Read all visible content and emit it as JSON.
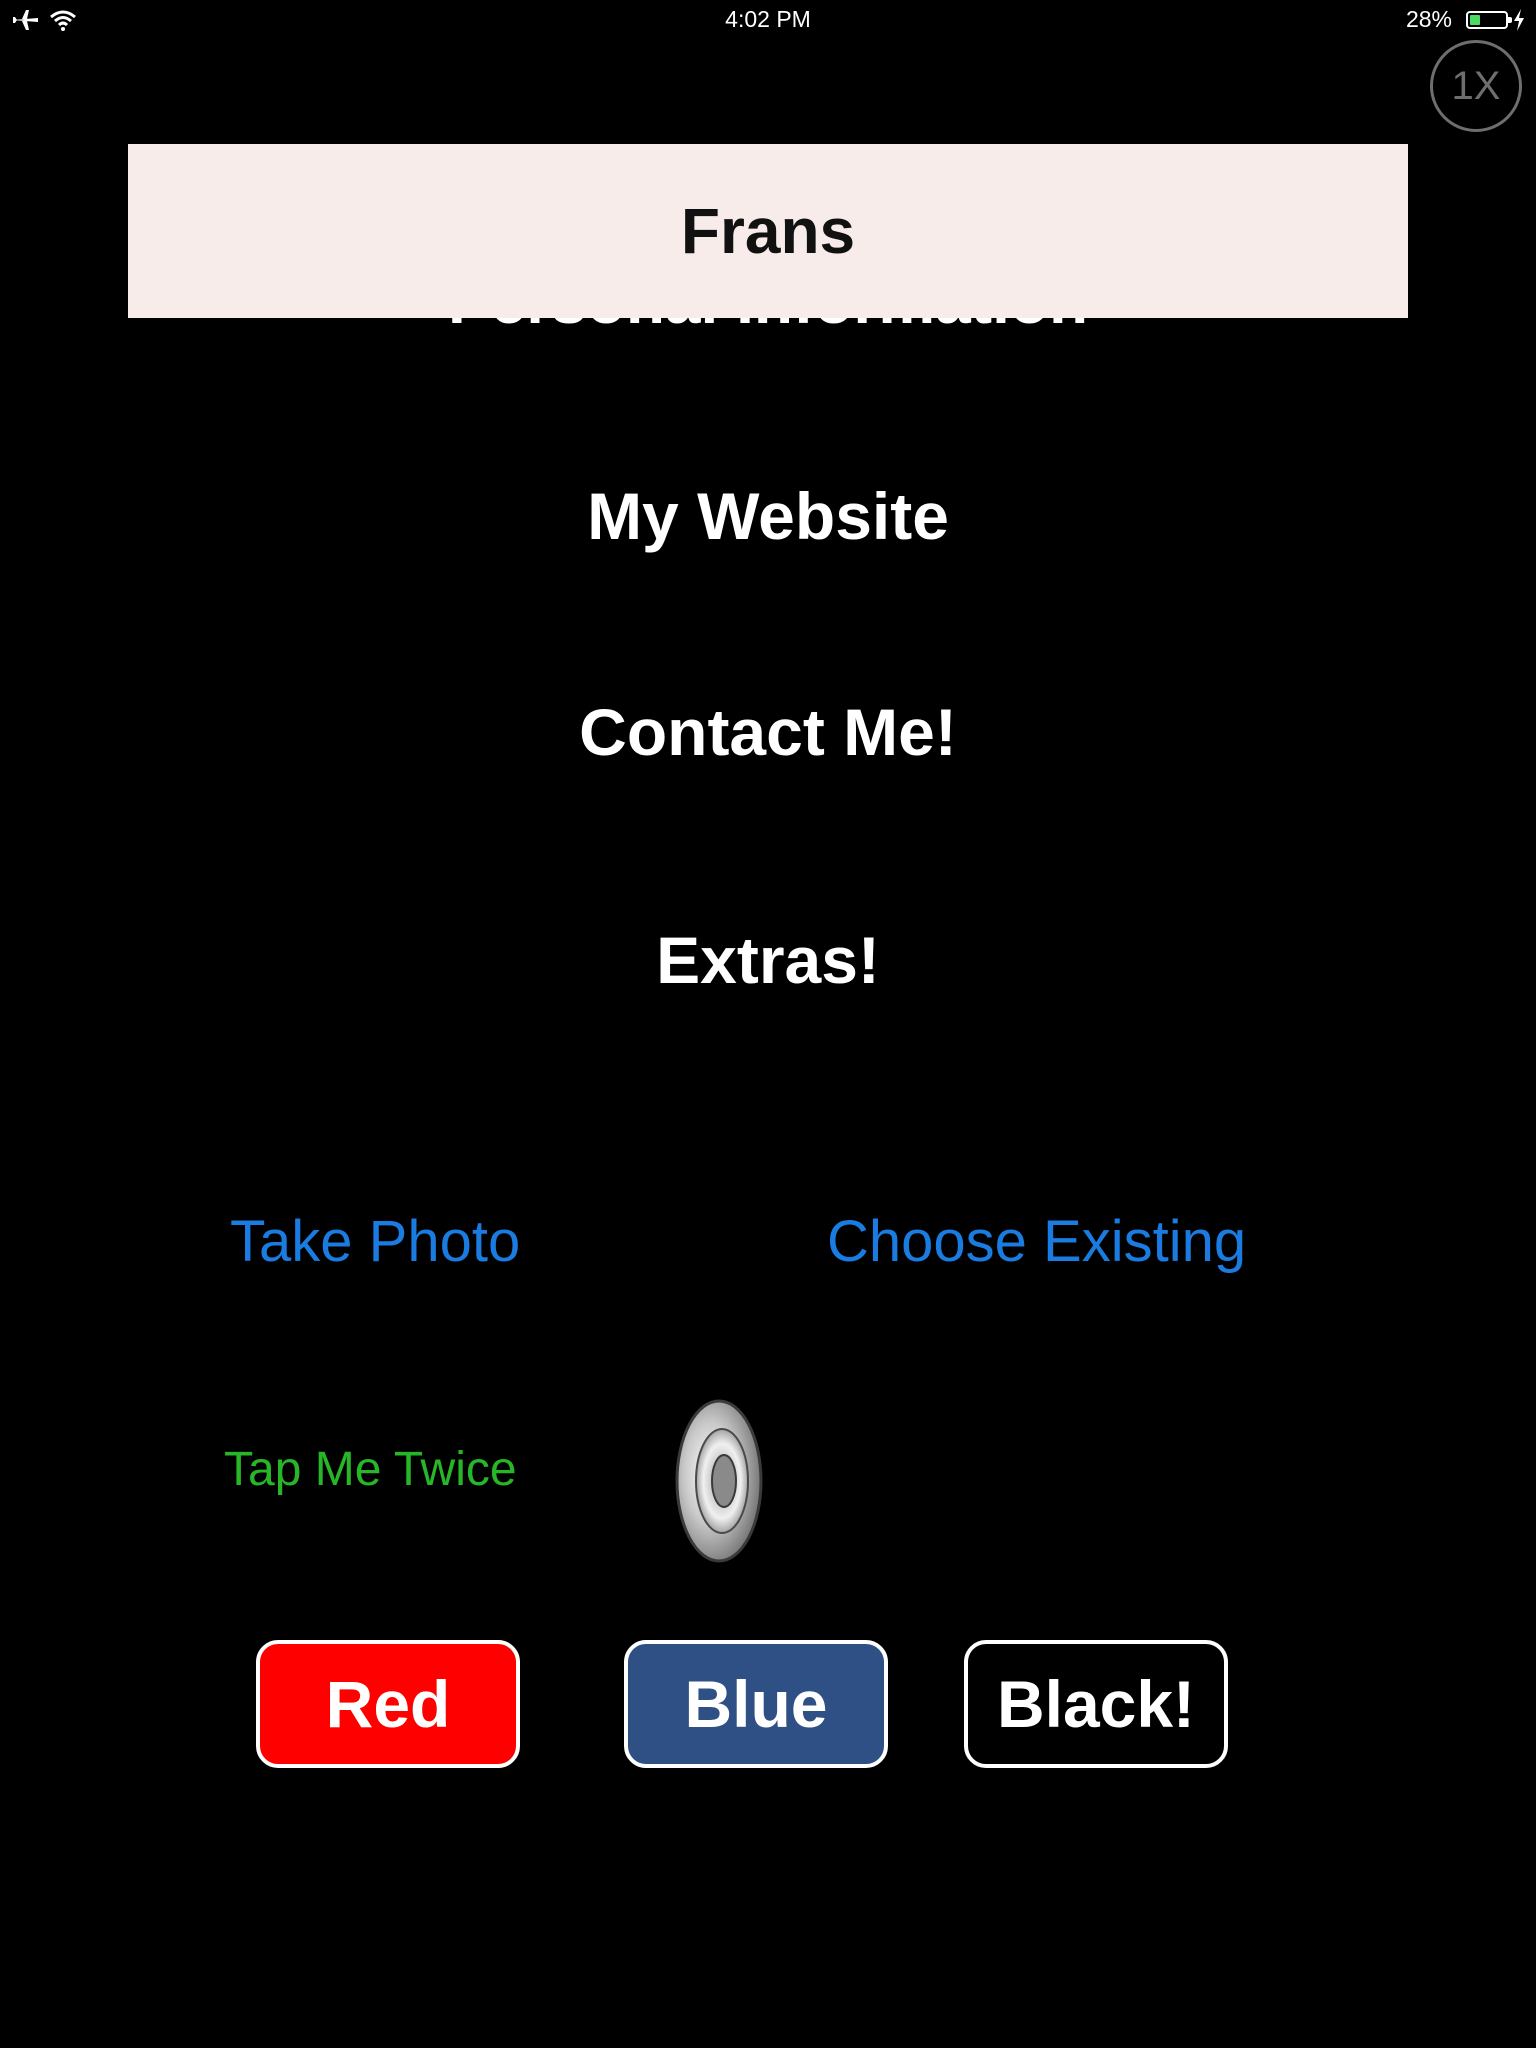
{
  "status_bar": {
    "time": "4:02 PM",
    "battery_percent": "28%",
    "battery_level": 0.28,
    "icons": [
      "airplane-icon",
      "wifi-icon",
      "battery-icon",
      "charging-bolt-icon"
    ]
  },
  "zoom_badge": "1X",
  "header": {
    "title": "Frans",
    "partially_hidden_heading": "Personal Information"
  },
  "menu": {
    "items": [
      {
        "label": "My Website"
      },
      {
        "label": "Contact Me!"
      },
      {
        "label": "Extras!"
      }
    ]
  },
  "photo": {
    "take_photo": "Take Photo",
    "choose_existing": "Choose Existing"
  },
  "sound": {
    "tap_label": "Tap Me Twice",
    "icon": "speaker-icon"
  },
  "color_buttons": [
    {
      "label": "Red",
      "color": "#ff0000"
    },
    {
      "label": "Blue",
      "color": "#2f5085"
    },
    {
      "label": "Black!",
      "color": "#000000"
    }
  ],
  "colors": {
    "background": "#000000",
    "header_background": "#f7ecea",
    "link_blue": "#1a7be0",
    "tap_green": "#27b627"
  }
}
